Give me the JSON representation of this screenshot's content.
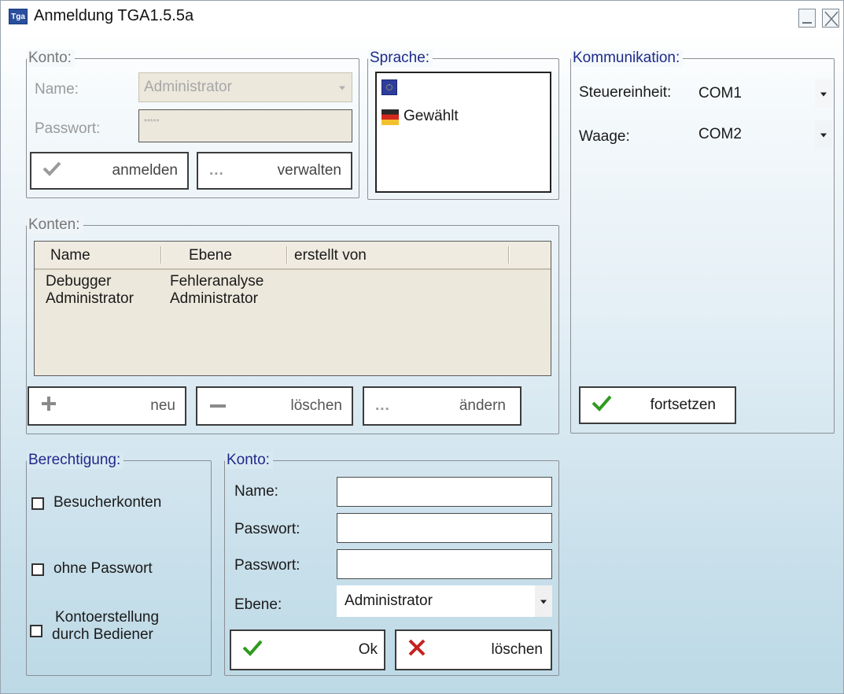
{
  "window": {
    "title": "Anmeldung TGA1.5.5a",
    "app_icon": "Tga"
  },
  "login_group": {
    "legend": "Konto:",
    "name_label": "Name:",
    "name_value": "Administrator",
    "password_label": "Passwort:",
    "password_value": "*****",
    "login_button": "anmelden",
    "manage_button": "verwalten",
    "manage_icon_text": "..."
  },
  "language_group": {
    "legend": "Sprache:",
    "items": [
      {
        "icon": "eu-flag-icon",
        "label": ""
      },
      {
        "icon": "german-flag-icon",
        "label": "Gewählt"
      }
    ]
  },
  "communication_group": {
    "legend": "Kommunikation:",
    "control_unit_label": "Steuereinheit:",
    "control_unit_value": "COM1",
    "scale_label": "Waage:",
    "scale_value": "COM2",
    "continue_button": "fortsetzen"
  },
  "accounts_group": {
    "legend": "Konten:",
    "columns": [
      "Name",
      "Ebene",
      "erstellt von"
    ],
    "rows": [
      [
        "Debugger",
        "Fehleranalyse",
        ""
      ],
      [
        "Administrator",
        "Administrator",
        ""
      ]
    ],
    "new_button": "neu",
    "delete_button": "löschen",
    "edit_button": "ändern",
    "edit_icon_text": "..."
  },
  "permission_group": {
    "legend": "Berechtigung:",
    "guest_accounts": "Besucherkonten",
    "no_password": "ohne Passwort",
    "operator_creation_line1": "Kontoerstellung",
    "operator_creation_line2": "durch Bediener"
  },
  "account_edit_group": {
    "legend": "Konto:",
    "name_label": "Name:",
    "password_label": "Passwort:",
    "password_confirm_label": "Passwort:",
    "level_label": "Ebene:",
    "level_value": "Administrator",
    "ok_button": "Ok",
    "delete_button": "löschen"
  }
}
